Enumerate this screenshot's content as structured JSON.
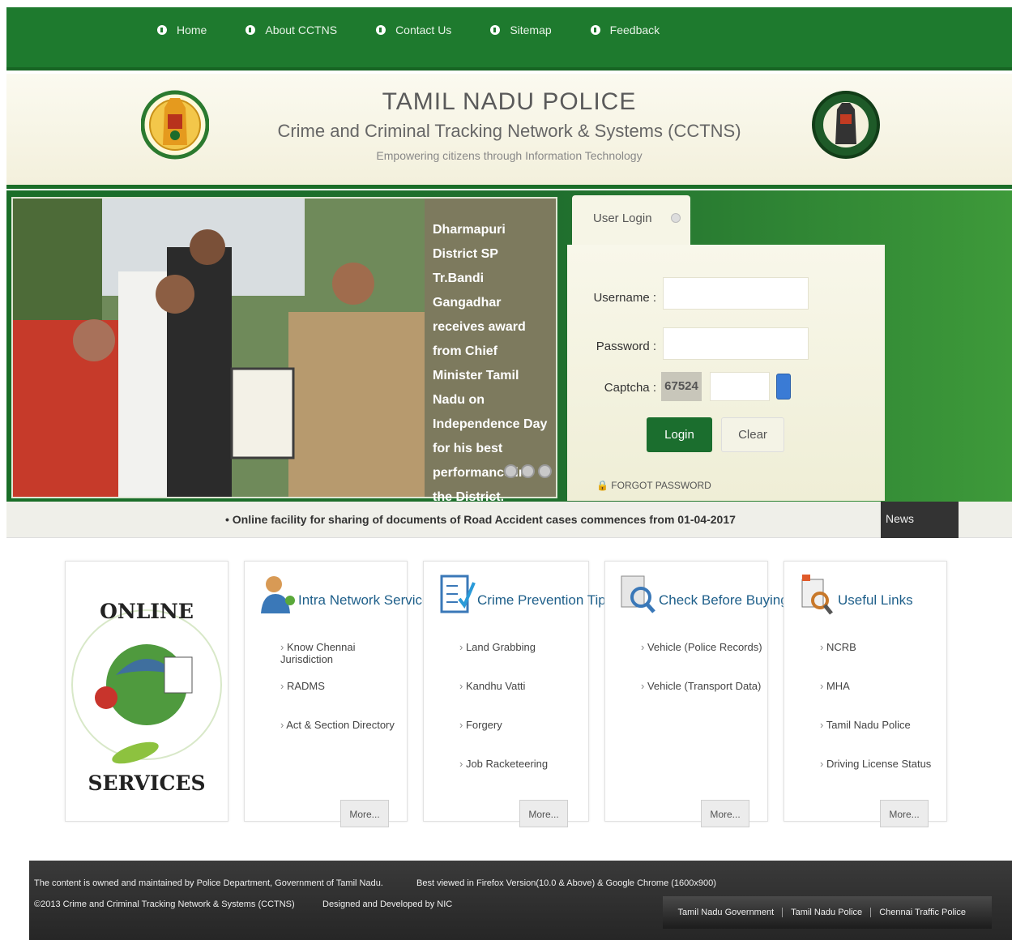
{
  "nav": {
    "items": [
      "Home",
      "About CCTNS",
      "Contact Us",
      "Sitemap",
      "Feedback"
    ]
  },
  "header": {
    "title": "TAMIL NADU POLICE",
    "subtitle": "Crime and Criminal Tracking Network & Systems (CCTNS)",
    "tagline": "Empowering citizens through Information Technology"
  },
  "slider": {
    "caption": "Dharmapuri District SP Tr.Bandi Gangadhar receives award from Chief Minister Tamil Nadu on Independence Day for his best performance in the District."
  },
  "login": {
    "tab": "User Login",
    "username_label": "Username :",
    "password_label": "Password :",
    "captcha_label": "Captcha :",
    "captcha_code": "67524",
    "login_button": "Login",
    "clear_button": "Clear",
    "forgot": "FORGOT PASSWORD"
  },
  "ticker": {
    "text": "• Online facility for sharing of documents of Road Accident cases commences from 01-04-2017",
    "news_label": "News"
  },
  "online": {
    "word_top": "ONLINE",
    "word_bottom": "SERVICES"
  },
  "cards": [
    {
      "title": "Intra Network Services",
      "items": [
        "Know Chennai Jurisdiction",
        "RADMS",
        "Act & Section Directory"
      ],
      "more": "More..."
    },
    {
      "title": "Crime Prevention Tips",
      "items": [
        "Land Grabbing",
        "Kandhu Vatti",
        "Forgery",
        "Job Racketeering"
      ],
      "more": "More..."
    },
    {
      "title": "Check Before Buying",
      "items": [
        "Vehicle (Police Records)",
        "Vehicle (Transport Data)"
      ],
      "more": "More..."
    },
    {
      "title": "Useful Links",
      "items": [
        "NCRB",
        "MHA",
        "Tamil Nadu Police",
        "Driving License Status"
      ],
      "more": "More..."
    }
  ],
  "footer": {
    "line1": "The content is owned and maintained by Police Department, Government of Tamil Nadu.",
    "line2": "©2013 Crime and Criminal Tracking Network & Systems (CCTNS)",
    "browser": "Best viewed in Firefox Version(10.0 & Above) & Google Chrome (1600x900)",
    "designed": "Designed and Developed by NIC",
    "links": [
      "Tamil Nadu Government",
      "Tamil Nadu Police",
      "Chennai Traffic Police"
    ]
  }
}
